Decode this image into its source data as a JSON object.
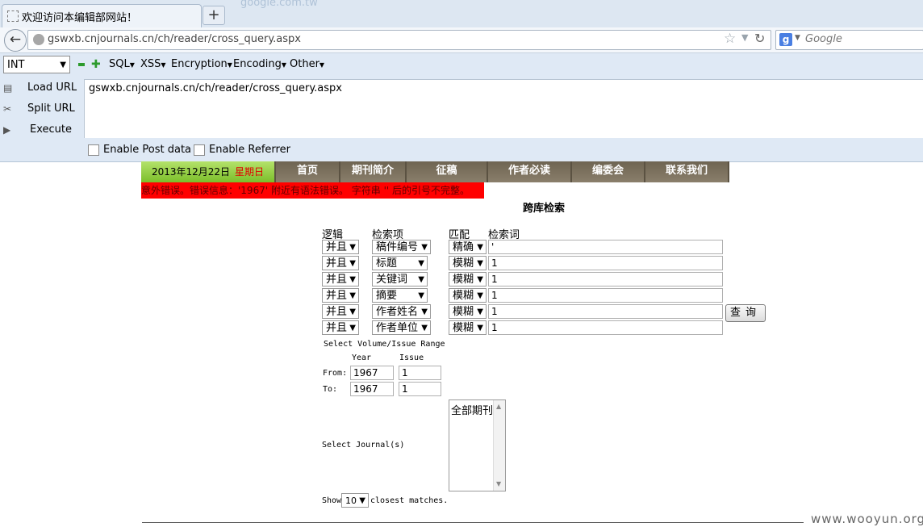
{
  "browser": {
    "tab_title": "欢迎访问本编辑部网站！",
    "new_tab_label": "+",
    "ghost_text": "google.com.tw",
    "url": "gswxb.cnjournals.cn/ch/reader/cross_query.aspx",
    "search_engine_letter": "g",
    "search_placeholder": "Google"
  },
  "hackbar": {
    "select_value": "INT",
    "menus": [
      "SQL",
      "XSS",
      "Encryption",
      "Encoding",
      "Other"
    ],
    "side_buttons": [
      "Load URL",
      "Split URL",
      "Execute"
    ],
    "textarea_value": "gswxb.cnjournals.cn/ch/reader/cross_query.aspx",
    "enable_post_label": "Enable Post data",
    "enable_referrer_label": "Enable Referrer"
  },
  "site": {
    "date": "2013年12月22日",
    "weekday": "星期日",
    "nav": [
      "首页",
      "期刊简介",
      "征稿",
      "作者必读",
      "编委会",
      "联系我们"
    ],
    "error": "意外错误。错误信息：'1967' 附近有语法错误。 字符串 '' 后的引号不完整。",
    "page_title": "跨库检索"
  },
  "form": {
    "headers": [
      "逻辑",
      "检索项",
      "匹配",
      "检索词"
    ],
    "rows": [
      {
        "logic": "并且",
        "field": "稿件编号",
        "match": "精确",
        "term": "'"
      },
      {
        "logic": "并且",
        "field": "标题",
        "match": "模糊",
        "term": "1"
      },
      {
        "logic": "并且",
        "field": "关键词",
        "match": "模糊",
        "term": "1"
      },
      {
        "logic": "并且",
        "field": "摘要",
        "match": "模糊",
        "term": "1"
      },
      {
        "logic": "并且",
        "field": "作者姓名",
        "match": "模糊",
        "term": "1"
      },
      {
        "logic": "并且",
        "field": "作者单位",
        "match": "模糊",
        "term": "1"
      }
    ],
    "query_button": "查询",
    "range_title": "Select Volume/Issue Range",
    "year_label": "Year",
    "issue_label": "Issue",
    "from_label": "From:",
    "to_label": "To:",
    "from_year": "1967",
    "from_issue": "1",
    "to_year": "1967",
    "to_issue": "1",
    "journal_label": "Select Journal(s)",
    "journal_option": "全部期刊",
    "show_label": "Show",
    "show_value": "10",
    "matches_label": "closest matches."
  },
  "watermark": "www.wooyun.org"
}
